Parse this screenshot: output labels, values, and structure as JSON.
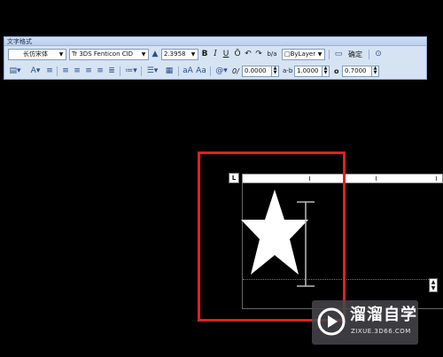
{
  "toolbar": {
    "title": "文字格式",
    "style": "长仿宋体",
    "font": "Tr 3DS Fenticon CID",
    "height": "2.3958",
    "bold": "B",
    "italic": "I",
    "underline": "U",
    "overline": "Ō",
    "undo": "↶",
    "redo": "↷",
    "stack": "b/a",
    "color": "□ByLayer",
    "ok": "确定",
    "oblique": "0/",
    "oblique_value": "0.0000",
    "tracking": "a-b",
    "tracking_value": "1.0000",
    "width_factor": "o",
    "width_value": "0.7000"
  },
  "editor": {
    "tab_marker": "L"
  },
  "watermark": {
    "name": "溜溜自学",
    "url": "ZIXUE.3D66.COM"
  },
  "colors": {
    "highlight": "#e02020",
    "toolbar_bg": "#d6e3f3"
  }
}
